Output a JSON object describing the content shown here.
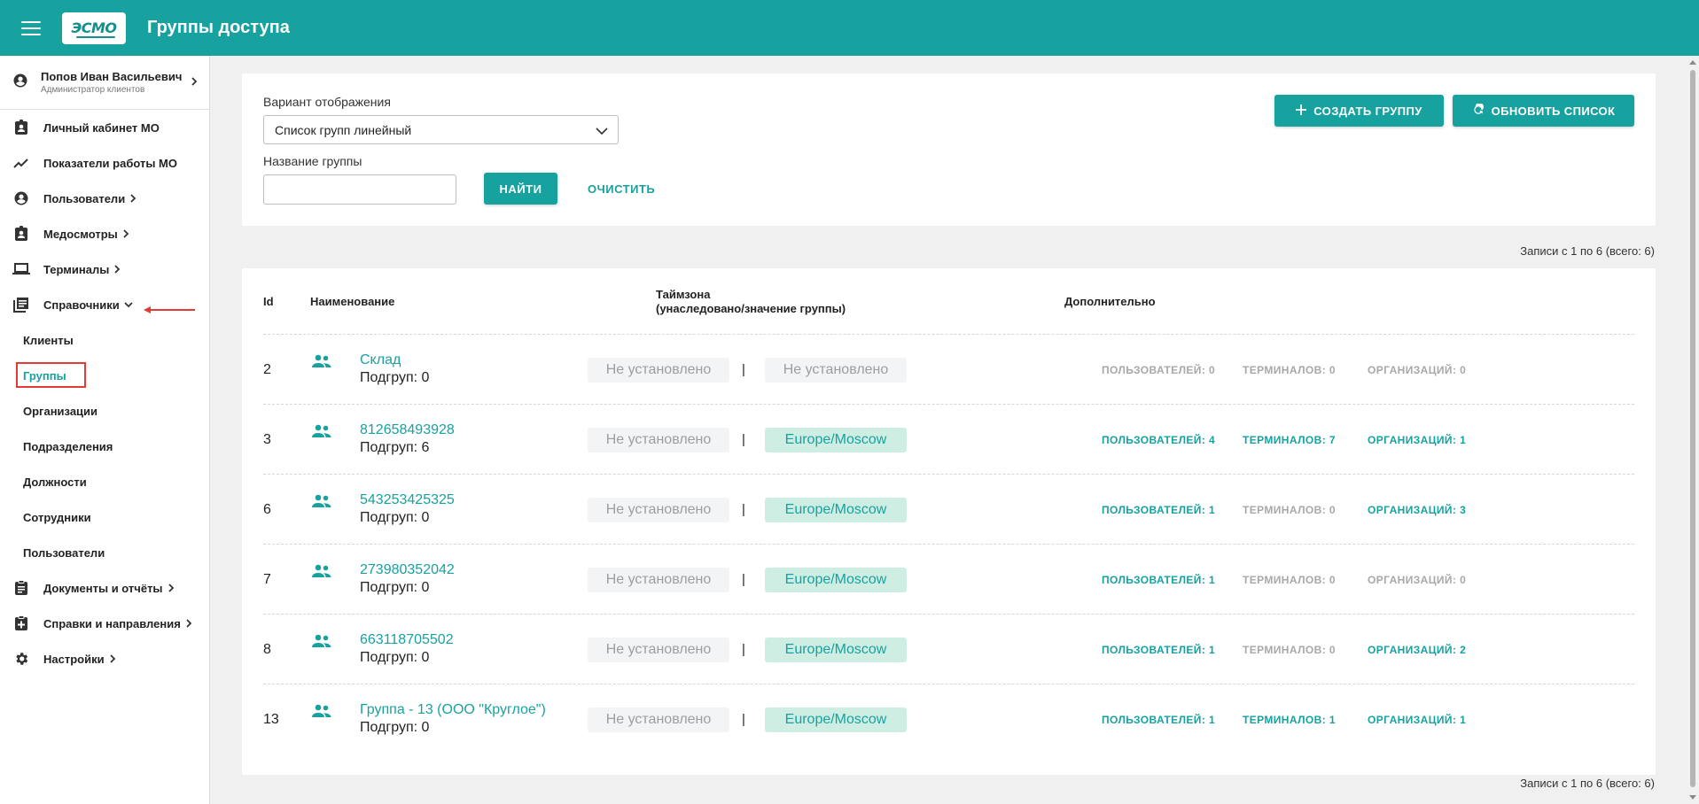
{
  "header": {
    "logo_text": "ЭСМО",
    "title": "Группы доступа"
  },
  "sidebar": {
    "user": {
      "name": "Попов Иван Васильевич",
      "role": "Администратор клиентов"
    },
    "items": [
      {
        "label": "Личный кабинет МО",
        "icon": "badge-icon"
      },
      {
        "label": "Показатели работы МО",
        "icon": "trending-line-icon"
      },
      {
        "label": "Пользователи",
        "icon": "account-circle-icon"
      },
      {
        "label": "Медосмотры",
        "icon": "badge-icon"
      },
      {
        "label": "Терминалы",
        "icon": "laptop-icon"
      },
      {
        "label": "Справочники",
        "icon": "library-books-icon"
      }
    ],
    "subitems": [
      "Клиенты",
      "Группы",
      "Организации",
      "Подразделения",
      "Должности",
      "Сотрудники",
      "Пользователи"
    ],
    "bottom_items": [
      {
        "label": "Документы и отчёты",
        "icon": "clipboard-icon"
      },
      {
        "label": "Справки и направления",
        "icon": "clipboard-plus-icon"
      },
      {
        "label": "Настройки",
        "icon": "gear-icon"
      }
    ],
    "active_subitem": "Группы"
  },
  "filters": {
    "view_label": "Вариант отображения",
    "view_value": "Список групп линейный",
    "name_label": "Название группы",
    "name_value": "",
    "find_label": "НАЙТИ",
    "clear_label": "ОЧИСТИТЬ",
    "create_label": "СОЗДАТЬ ГРУППУ",
    "refresh_label": "ОБНОВИТЬ СПИСОК"
  },
  "records_text": "Записи с 1 по 6 (всего: 6)",
  "table": {
    "headers": {
      "id": "Id",
      "name": "Наименование",
      "tz_line1": "Таймзона",
      "tz_line2": "(унаследовано/значение группы)",
      "extra": "Дополнительно"
    },
    "tz_separator": "|",
    "rows": [
      {
        "id": "2",
        "name": "Склад",
        "sub": "Подгруп: 0",
        "tz_inherited": "Не установлено",
        "tz_group": "Не установлено",
        "tz_group_set": false,
        "users": "ПОЛЬЗОВАТЕЛЕЙ: 0",
        "users_on": false,
        "terminals": "ТЕРМИНАЛОВ: 0",
        "terminals_on": false,
        "orgs": "ОРГАНИЗАЦИЙ: 0",
        "orgs_on": false
      },
      {
        "id": "3",
        "name": "812658493928",
        "sub": "Подгруп: 6",
        "tz_inherited": "Не установлено",
        "tz_group": "Europe/Moscow",
        "tz_group_set": true,
        "users": "ПОЛЬЗОВАТЕЛЕЙ: 4",
        "users_on": true,
        "terminals": "ТЕРМИНАЛОВ: 7",
        "terminals_on": true,
        "orgs": "ОРГАНИЗАЦИЙ: 1",
        "orgs_on": true
      },
      {
        "id": "6",
        "name": "543253425325",
        "sub": "Подгруп: 0",
        "tz_inherited": "Не установлено",
        "tz_group": "Europe/Moscow",
        "tz_group_set": true,
        "users": "ПОЛЬЗОВАТЕЛЕЙ: 1",
        "users_on": true,
        "terminals": "ТЕРМИНАЛОВ: 0",
        "terminals_on": false,
        "orgs": "ОРГАНИЗАЦИЙ: 3",
        "orgs_on": true
      },
      {
        "id": "7",
        "name": "273980352042",
        "sub": "Подгруп: 0",
        "tz_inherited": "Не установлено",
        "tz_group": "Europe/Moscow",
        "tz_group_set": true,
        "users": "ПОЛЬЗОВАТЕЛЕЙ: 1",
        "users_on": true,
        "terminals": "ТЕРМИНАЛОВ: 0",
        "terminals_on": false,
        "orgs": "ОРГАНИЗАЦИЙ: 0",
        "orgs_on": false
      },
      {
        "id": "8",
        "name": "663118705502",
        "sub": "Подгруп: 0",
        "tz_inherited": "Не установлено",
        "tz_group": "Europe/Moscow",
        "tz_group_set": true,
        "users": "ПОЛЬЗОВАТЕЛЕЙ: 1",
        "users_on": true,
        "terminals": "ТЕРМИНАЛОВ: 0",
        "terminals_on": false,
        "orgs": "ОРГАНИЗАЦИЙ: 2",
        "orgs_on": true
      },
      {
        "id": "13",
        "name": "Группа - 13 (ООО \"Круглое\")",
        "sub": "Подгруп: 0",
        "tz_inherited": "Не установлено",
        "tz_group": "Europe/Moscow",
        "tz_group_set": true,
        "users": "ПОЛЬЗОВАТЕЛЕЙ: 1",
        "users_on": true,
        "terminals": "ТЕРМИНАЛОВ: 1",
        "terminals_on": true,
        "orgs": "ОРГАНИЗАЦИЙ: 1",
        "orgs_on": true
      }
    ]
  },
  "colors": {
    "accent": "#17a2a0",
    "highlight": "#e53935",
    "tz_set_bg": "#cfeee3"
  }
}
